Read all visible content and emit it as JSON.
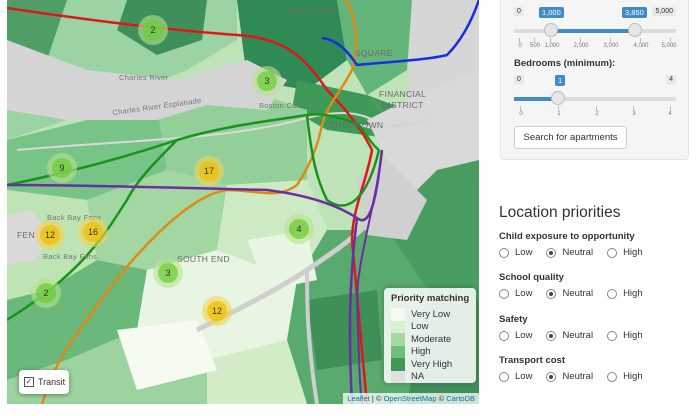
{
  "map": {
    "labels": {
      "west_end": "WEST END",
      "charles_river": "Charles River",
      "esplanade": "Charles River Esplanade",
      "boston_common": "Boston Com...",
      "financial": "FINANCIAL",
      "district": "DISTRICT",
      "chinatown": "CHINATOWN",
      "back_bay_fens_1": "Back Bay Fens",
      "back_bay_fens_2": "Back Bay Fens",
      "south_end": "SOUTH END",
      "sq": "SQUARE",
      "fen": "FEN"
    },
    "clusters": [
      {
        "count": "2",
        "color": "green"
      },
      {
        "count": "3",
        "color": "green"
      },
      {
        "count": "9",
        "color": "green"
      },
      {
        "count": "17",
        "color": "yellow"
      },
      {
        "count": "12",
        "color": "yellow"
      },
      {
        "count": "16",
        "color": "yellow"
      },
      {
        "count": "4",
        "color": "green"
      },
      {
        "count": "3",
        "color": "green"
      },
      {
        "count": "2",
        "color": "green"
      },
      {
        "count": "12",
        "color": "yellow"
      }
    ],
    "legend": {
      "title": "Priority matching",
      "items": [
        {
          "label": "Very Low",
          "color": "#f3fbee"
        },
        {
          "label": "Low",
          "color": "#d9f0d0"
        },
        {
          "label": "Moderate",
          "color": "#a6d9a0"
        },
        {
          "label": "High",
          "color": "#6fbf78"
        },
        {
          "label": "Very High",
          "color": "#3f9a57"
        },
        {
          "label": "NA",
          "color": "#e0e0e0"
        }
      ]
    },
    "transit_toggle": {
      "label": "Transit",
      "checked": true
    },
    "attribution": {
      "leaflet": "Leaflet",
      "sep1": "| ©",
      "osm": "OpenStreetMap",
      "sep2": "©",
      "carto": "CartoDB"
    },
    "transit_colors": {
      "red": "#e0161b",
      "orange": "#e08a16",
      "green": "#19931d",
      "blue": "#1430e0",
      "purple": "#6b2fa2"
    }
  },
  "filters": {
    "price": {
      "min_edge": "0",
      "max_edge": "5,000",
      "low": "1,000",
      "high": "3,850",
      "ticks": [
        "0",
        "500",
        "1,000",
        "2,000",
        "3,000",
        "4,000",
        "5,000"
      ]
    },
    "bedrooms": {
      "label": "Bedrooms (minimum):",
      "min_edge": "0",
      "max_edge": "4",
      "value": "1",
      "ticks": [
        "0",
        "1",
        "2",
        "3",
        "4"
      ]
    },
    "search_button": "Search for apartments"
  },
  "priorities": {
    "title": "Location priorities",
    "options": [
      "Low",
      "Neutral",
      "High"
    ],
    "items": [
      {
        "label": "Child exposure to opportunity",
        "selected": "Neutral"
      },
      {
        "label": "School quality",
        "selected": "Neutral"
      },
      {
        "label": "Safety",
        "selected": "Neutral"
      },
      {
        "label": "Transport cost",
        "selected": "Neutral"
      }
    ]
  }
}
